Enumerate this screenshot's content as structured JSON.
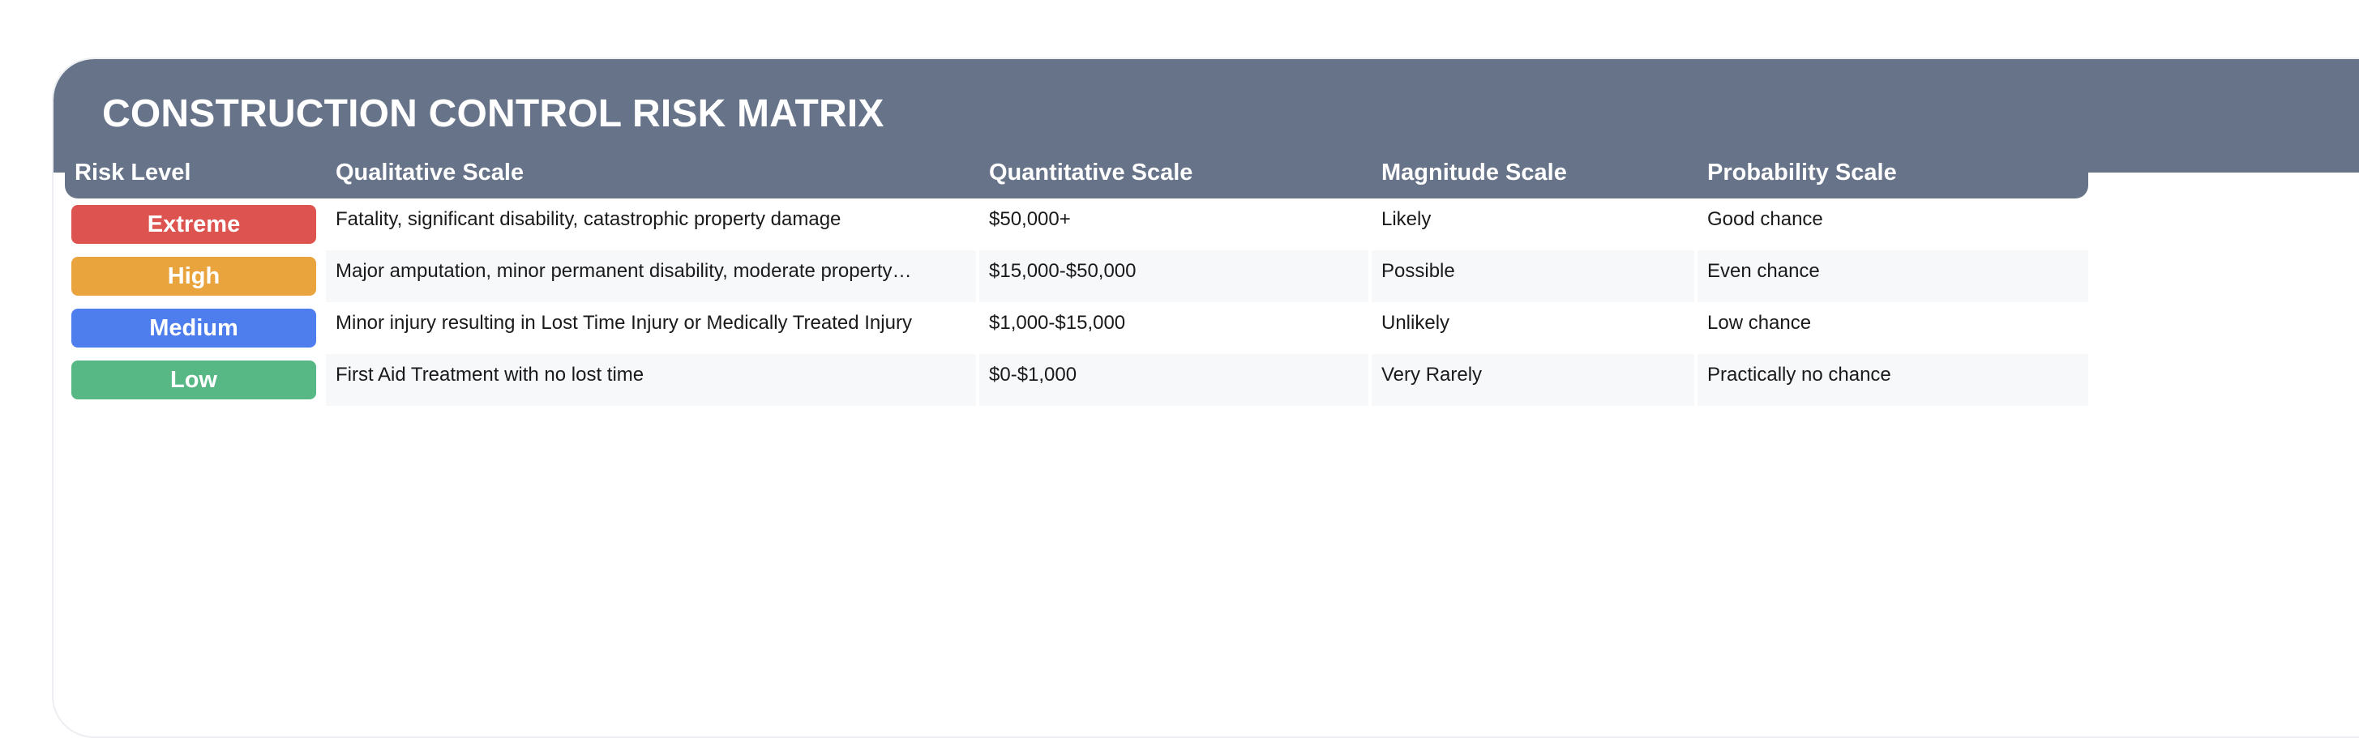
{
  "header": {
    "title": "CONSTRUCTION CONTROL RISK MATRIX"
  },
  "table": {
    "columns": [
      "Risk Level",
      "Qualitative Scale",
      "Quantitative Scale",
      "Magnitude Scale",
      "Probability Scale"
    ],
    "rows": [
      {
        "level": "Extreme",
        "color": "#dd534f",
        "qualitative": "Fatality, significant disability, catastrophic property damage",
        "quantitative": "$50,000+",
        "magnitude": "Likely",
        "probability": "Good chance"
      },
      {
        "level": "High",
        "color": "#e9a43e",
        "qualitative": "Major amputation, minor permanent disability, moderate property…",
        "quantitative": "$15,000-$50,000",
        "magnitude": "Possible",
        "probability": "Even chance"
      },
      {
        "level": "Medium",
        "color": "#4e7ded",
        "qualitative": "Minor injury resulting in Lost Time Injury or Medically Treated Injury",
        "quantitative": "$1,000-$15,000",
        "magnitude": "Unlikely",
        "probability": "Low chance"
      },
      {
        "level": "Low",
        "color": "#57b885",
        "qualitative": "First Aid Treatment with no lost time",
        "quantitative": "$0-$1,000",
        "magnitude": "Very Rarely",
        "probability": "Practically no chance"
      }
    ]
  },
  "colors": {
    "header_bg": "#667389",
    "stripe_bg": "#f7f8fa"
  }
}
